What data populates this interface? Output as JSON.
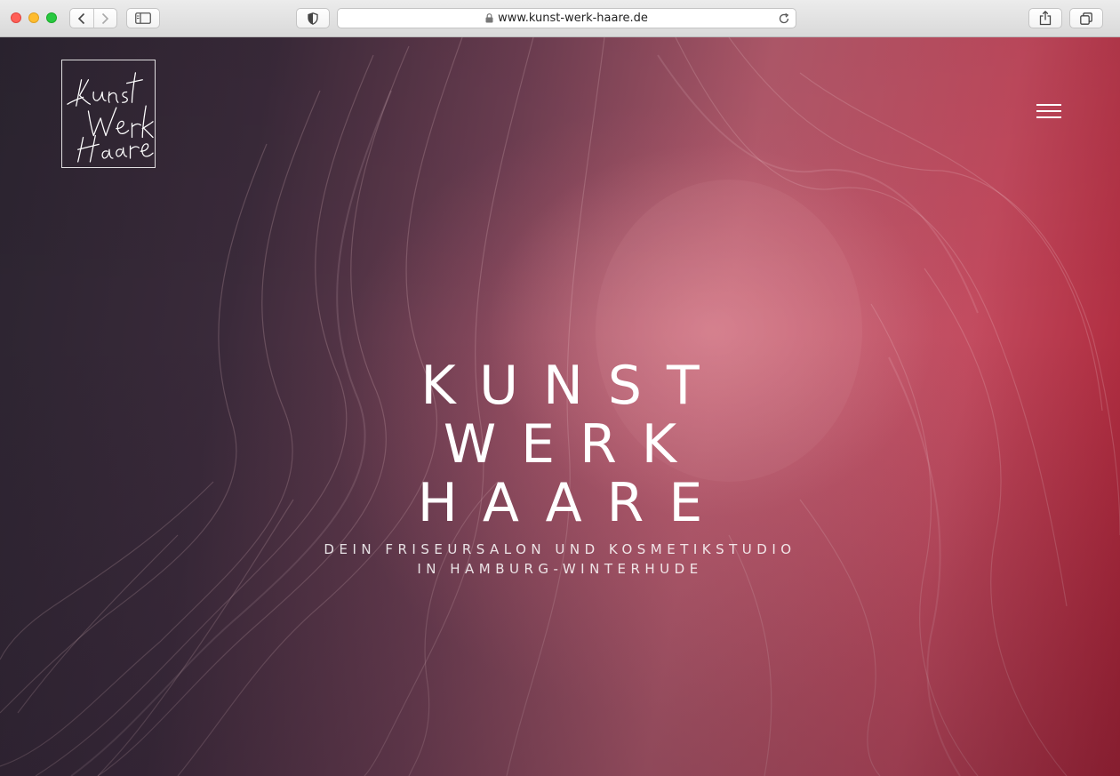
{
  "browser": {
    "url": "www.kunst-werk-haare.de"
  },
  "site": {
    "logo_text": [
      "Kunst",
      "Werk",
      "Haare"
    ],
    "hero_title": [
      "KUNST",
      "WERK",
      "HAARE"
    ],
    "hero_subtitle": [
      "DEIN FRISEURSALON UND KOSMETIKSTUDIO",
      "IN HAMBURG-WINTERHUDE"
    ]
  },
  "colors": {
    "gradient_left": "#2b2430",
    "gradient_right": "#a82033",
    "text": "#ffffff"
  }
}
